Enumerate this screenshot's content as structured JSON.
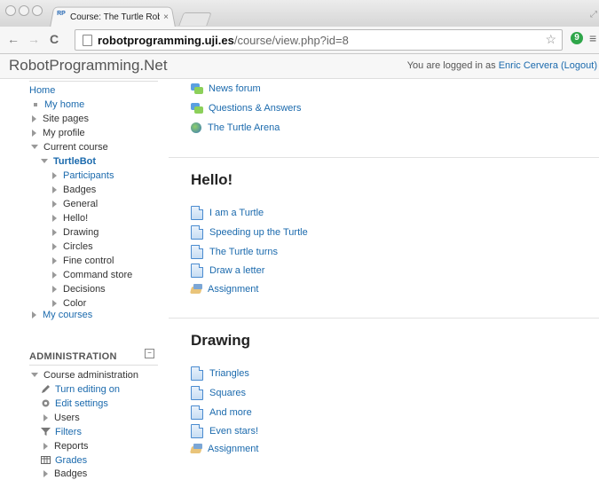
{
  "browser": {
    "tab_title": "Course: The Turtle Robot",
    "tab_favicon": "RP",
    "tab_close": "×",
    "url_host": "robotprogramming.uji.es",
    "url_path": "/course/view.php?id=8",
    "back": "←",
    "forward": "→",
    "reload": "C",
    "star": "☆",
    "menu": "≡",
    "ext_badge": "9"
  },
  "header": {
    "site_name": "RobotProgramming.Net",
    "logged_in_prefix": "You are logged in as",
    "user_name": "Enric Cervera",
    "logout": "(Logout)"
  },
  "navigation": {
    "home": "Home",
    "my_home": "My home",
    "site_pages": "Site pages",
    "my_profile": "My profile",
    "current_course": "Current course",
    "course": "TurtleBot",
    "course_items": [
      "Participants",
      "Badges",
      "General",
      "Hello!",
      "Drawing",
      "Circles",
      "Fine control",
      "Command store",
      "Decisions",
      "Color"
    ],
    "my_courses": "My courses"
  },
  "administration": {
    "title": "ADMINISTRATION",
    "collapse": "−",
    "course_admin": "Course administration",
    "items": [
      "Turn editing on",
      "Edit settings",
      "Users",
      "Filters",
      "Reports",
      "Grades",
      "Badges"
    ]
  },
  "main": {
    "top_items": [
      "News forum",
      "Questions & Answers",
      "The Turtle Arena"
    ],
    "sections": [
      {
        "title": "Hello!",
        "items": [
          "I am a Turtle",
          "Speeding up the Turtle",
          "The Turtle turns",
          "Draw a letter",
          "Assignment"
        ]
      },
      {
        "title": "Drawing",
        "items": [
          "Triangles",
          "Squares",
          "And more",
          "Even stars!",
          "Assignment"
        ]
      }
    ]
  }
}
